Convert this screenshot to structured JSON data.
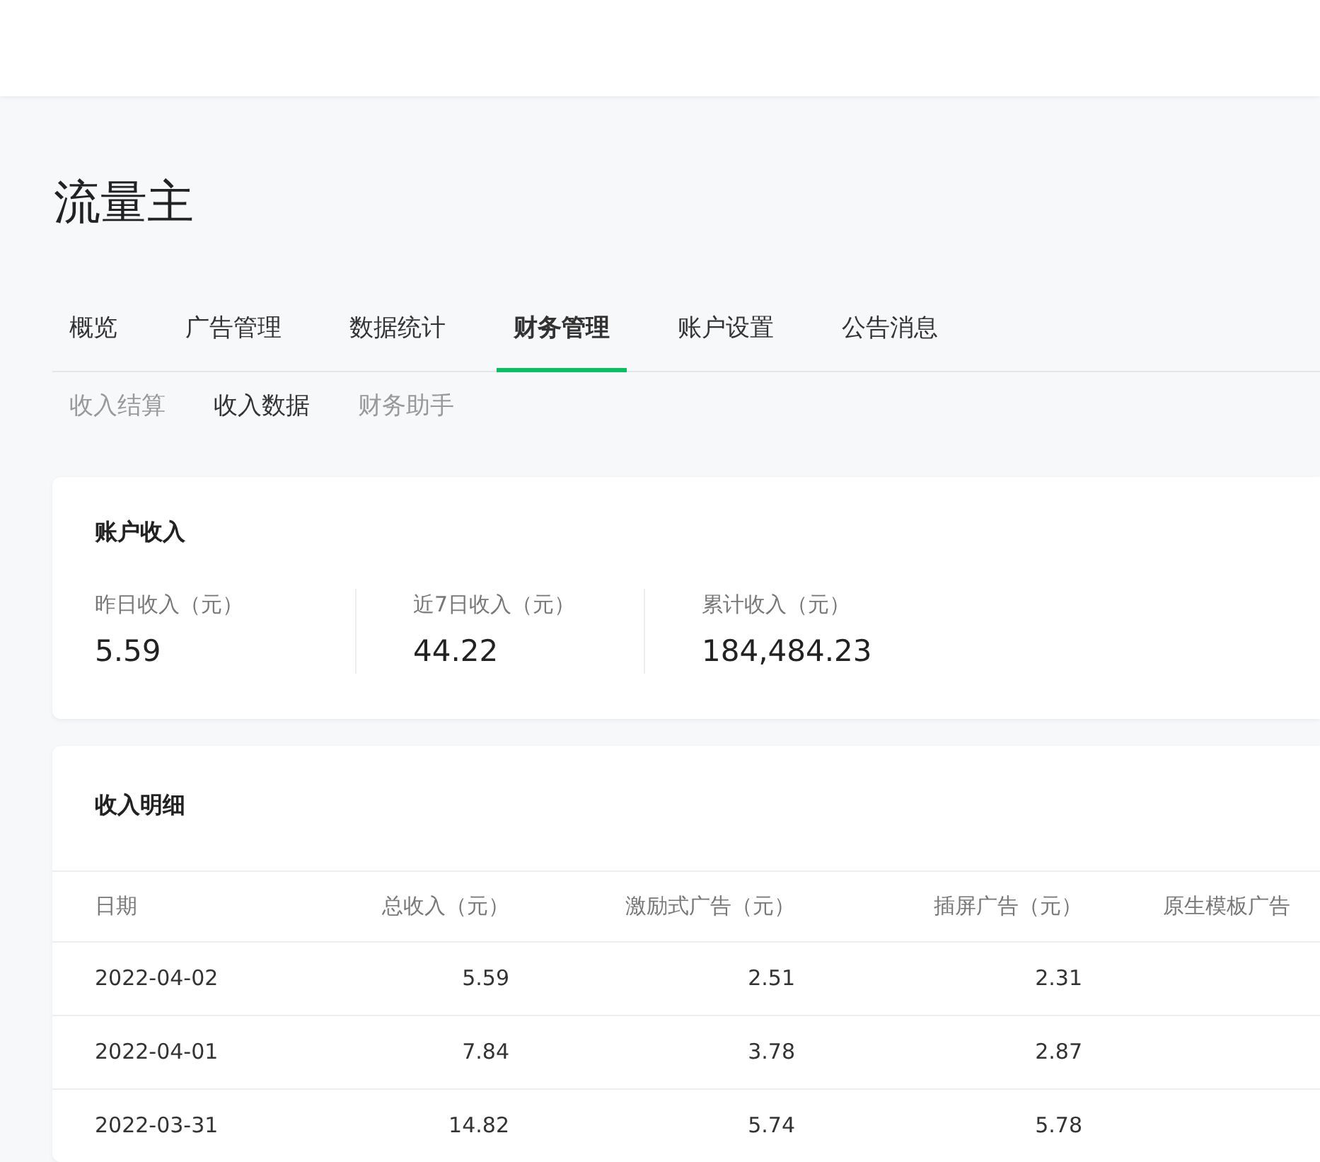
{
  "page_title": "流量主",
  "tabs": [
    {
      "label": "概览",
      "selected": false
    },
    {
      "label": "广告管理",
      "selected": false
    },
    {
      "label": "数据统计",
      "selected": false
    },
    {
      "label": "财务管理",
      "selected": true
    },
    {
      "label": "账户设置",
      "selected": false
    },
    {
      "label": "公告消息",
      "selected": false
    }
  ],
  "sub_tabs": [
    {
      "label": "收入结算",
      "selected": false
    },
    {
      "label": "收入数据",
      "selected": true
    },
    {
      "label": "财务助手",
      "selected": false
    }
  ],
  "account_income": {
    "title": "账户收入",
    "stats": [
      {
        "label": "昨日收入（元）",
        "value": "5.59"
      },
      {
        "label": "近7日收入（元）",
        "value": "44.22"
      },
      {
        "label": "累计收入（元）",
        "value": "184,484.23"
      }
    ]
  },
  "income_detail": {
    "title": "收入明细",
    "table": {
      "columns": [
        "日期",
        "总收入（元）",
        "激励式广告（元）",
        "插屏广告（元）",
        "原生模板广告"
      ],
      "rows": [
        [
          "2022-04-02",
          "5.59",
          "2.51",
          "2.31"
        ],
        [
          "2022-04-01",
          "7.84",
          "3.78",
          "2.87"
        ],
        [
          "2022-03-31",
          "14.82",
          "5.74",
          "5.78"
        ]
      ]
    }
  }
}
